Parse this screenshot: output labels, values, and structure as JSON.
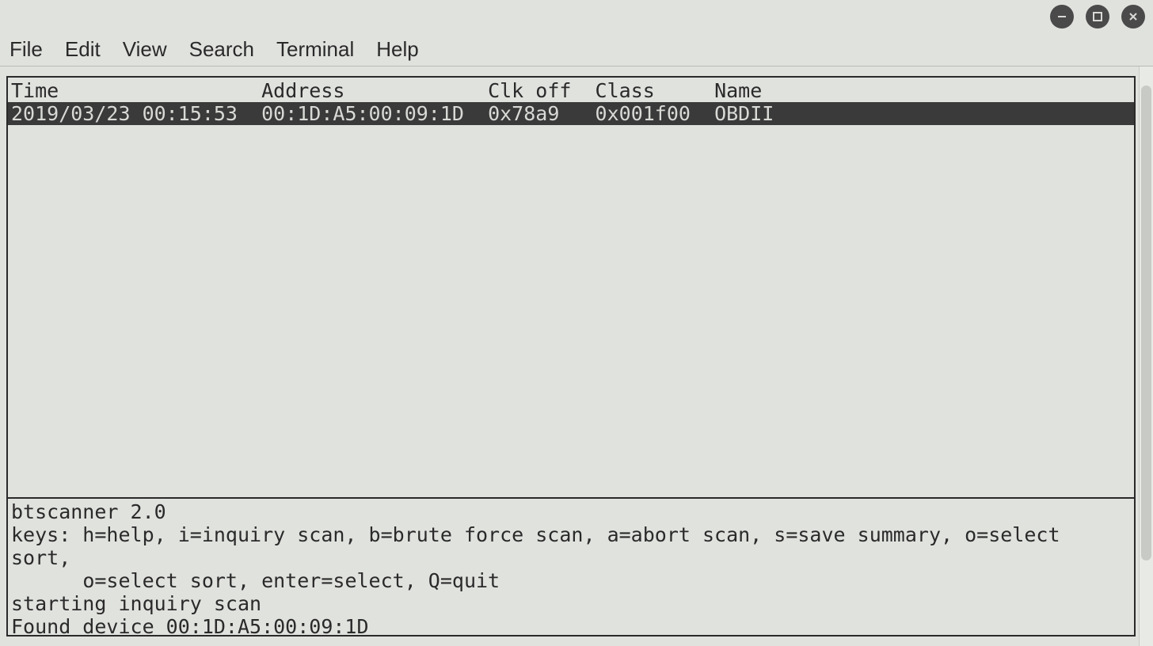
{
  "menubar": {
    "file": "File",
    "edit": "Edit",
    "view": "View",
    "search": "Search",
    "terminal": "Terminal",
    "help": "Help"
  },
  "table": {
    "headers": {
      "time": "Time",
      "address": "Address",
      "clkoff": "Clk off",
      "class": "Class",
      "name": "Name"
    },
    "rows": [
      {
        "time": "2019/03/23 00:15:53",
        "address": "00:1D:A5:00:09:1D",
        "clkoff": "0x78a9",
        "class": "0x001f00",
        "name": "OBDII"
      }
    ]
  },
  "status": {
    "line1": "btscanner 2.0",
    "line2": "keys: h=help, i=inquiry scan, b=brute force scan, a=abort scan, s=save summary, o=select sort,",
    "line3": "      o=select sort, enter=select, Q=quit",
    "line4": "starting inquiry scan",
    "line5": "Found device 00:1D:A5:00:09:1D"
  }
}
